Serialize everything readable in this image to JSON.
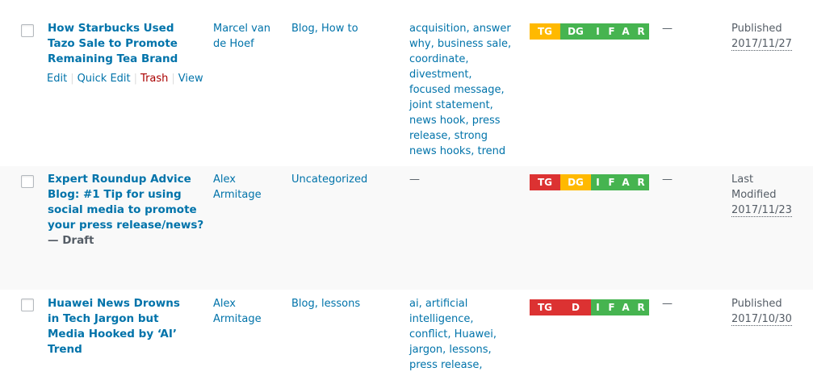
{
  "colors": {
    "link": "#0073aa",
    "trash": "#a00",
    "text": "#555d66",
    "score_green": "#46b450",
    "score_orange": "#ffb900",
    "score_red": "#dc3232"
  },
  "rows": [
    {
      "title": "How Starbucks Used Tazo Sale to Promote Remaining Tea Brand",
      "state": "",
      "actions": {
        "edit": "Edit",
        "quick_edit": "Quick Edit",
        "trash": "Trash",
        "view": "View"
      },
      "author": "Marcel van de Hoef",
      "categories": "Blog, How to",
      "tags": "acquisition, answer why, business sale, coordinate, divestment, focused message, joint statement, news hook, press release, strong news hooks, trend",
      "score": [
        {
          "label": "TG",
          "status": "orange"
        },
        {
          "label": "DG",
          "status": "green"
        },
        {
          "label": "I",
          "status": "green"
        },
        {
          "label": "F",
          "status": "green"
        },
        {
          "label": "A",
          "status": "green"
        },
        {
          "label": "R",
          "status": "green"
        }
      ],
      "comments": "—",
      "date_status": "Published",
      "date": "2017/11/27"
    },
    {
      "title": "Expert Roundup Advice Blog: #1 Tip for using social media to promote your press release/news?",
      "state": "— Draft",
      "author": "Alex Armitage",
      "categories": "Uncategorized",
      "tags": "—",
      "score": [
        {
          "label": "TG",
          "status": "red"
        },
        {
          "label": "DG",
          "status": "orange"
        },
        {
          "label": "I",
          "status": "green"
        },
        {
          "label": "F",
          "status": "green"
        },
        {
          "label": "A",
          "status": "green"
        },
        {
          "label": "R",
          "status": "green"
        }
      ],
      "comments": "—",
      "date_status": "Last Modified",
      "date": "2017/11/23"
    },
    {
      "title": "Huawei News Drowns in Tech Jargon but Media Hooked by ‘AI’ Trend",
      "state": "",
      "author": "Alex Armitage",
      "categories": "Blog, lessons",
      "tags": "ai, artificial intelligence, conflict, Huawei, jargon, lessons, press release,",
      "score": [
        {
          "label": "TG",
          "status": "red"
        },
        {
          "label": "D",
          "status": "red"
        },
        {
          "label": "I",
          "status": "green"
        },
        {
          "label": "F",
          "status": "green"
        },
        {
          "label": "A",
          "status": "green"
        },
        {
          "label": "R",
          "status": "green"
        }
      ],
      "comments": "—",
      "date_status": "Published",
      "date": "2017/10/30"
    }
  ]
}
